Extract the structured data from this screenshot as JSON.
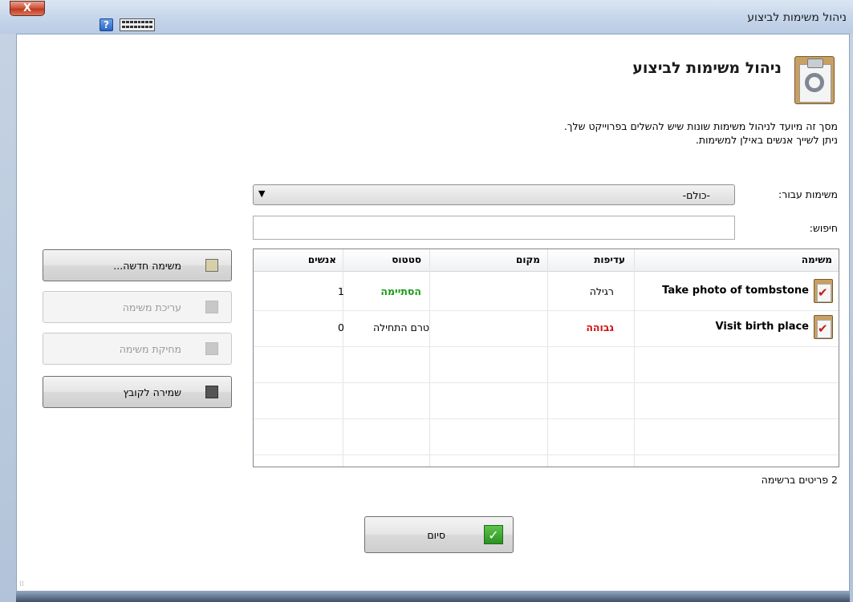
{
  "window": {
    "title": "ניהול משימות לביצוע",
    "close_label": "X",
    "help_label": "?"
  },
  "header": {
    "title": "ניהול משימות לביצוע",
    "icon": "clipboard-wrench-icon",
    "description_line1": "מסך זה מיועד לניהול משימות שונות שיש להשלים בפרוייקט שלך.",
    "description_line2": "ניתן לשייך אנשים באילן למשימות."
  },
  "filter": {
    "label": "משימות עבור:",
    "selected": "-כולם-"
  },
  "search": {
    "label": "חיפוש:",
    "value": ""
  },
  "table": {
    "columns": [
      "משימה",
      "עדיפות",
      "מקום",
      "סטטוס",
      "אנשים"
    ],
    "rows": [
      {
        "task": "Take photo of tombstone",
        "priority": "רגילה",
        "place": "",
        "status": "הסתיימה",
        "people": "1"
      },
      {
        "task": "Visit birth place",
        "priority": "גבוהה",
        "place": "",
        "status": "טרם התחילה",
        "people": "0"
      }
    ]
  },
  "buttons": {
    "new_task": "משימה חדשה...",
    "edit_task": "עריכת משימה",
    "delete_task": "מחיקת משימה",
    "save_file": "שמירה לקובץ",
    "done": "סיום"
  },
  "status": {
    "count_text": "2 פריטים ברשימה"
  },
  "colors": {
    "status_done": "#1a9a1a",
    "priority_high": "#d01010"
  }
}
